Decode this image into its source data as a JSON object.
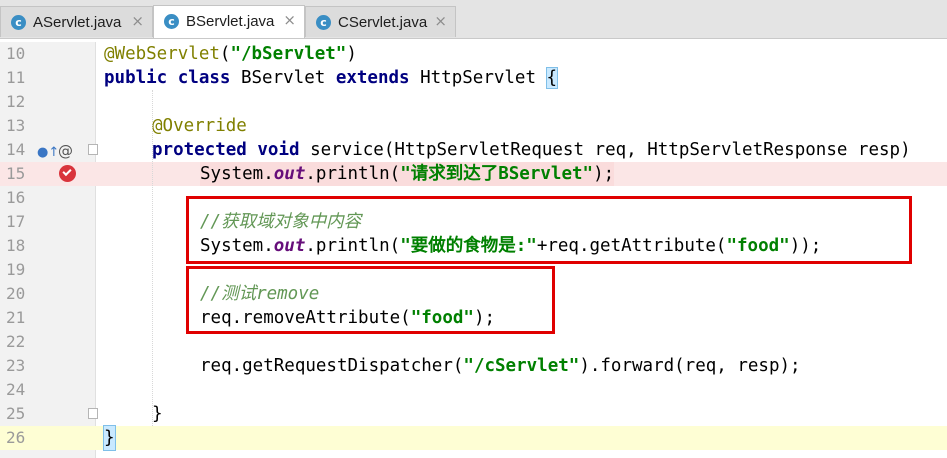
{
  "tabs": [
    {
      "label": "AServlet.java",
      "icon": "c",
      "active": false
    },
    {
      "label": "BServlet.java",
      "icon": "c",
      "active": true
    },
    {
      "label": "CServlet.java",
      "icon": "c",
      "active": false
    }
  ],
  "close_glyph": "×",
  "lines": [
    {
      "num": "10"
    },
    {
      "num": "11"
    },
    {
      "num": "12"
    },
    {
      "num": "13"
    },
    {
      "num": "14"
    },
    {
      "num": "15"
    },
    {
      "num": "16"
    },
    {
      "num": "17"
    },
    {
      "num": "18"
    },
    {
      "num": "19"
    },
    {
      "num": "20"
    },
    {
      "num": "21"
    },
    {
      "num": "22"
    },
    {
      "num": "23"
    },
    {
      "num": "24"
    },
    {
      "num": "25"
    },
    {
      "num": "26"
    }
  ],
  "code": {
    "l10": {
      "annotation": "@WebServlet",
      "p1": "(",
      "str": "\"/bServlet\"",
      "p2": ")"
    },
    "l11": {
      "kw1": "public",
      "kw2": "class",
      "cls": " BServlet ",
      "kw3": "extends",
      "sup": " HttpServlet ",
      "brace": "{"
    },
    "l13": {
      "annotation": "@Override"
    },
    "l14": {
      "kw1": "protected",
      "kw2": "void",
      "rest": " service(HttpServletRequest req, HttpServletResponse resp)"
    },
    "l15": {
      "pre": "System.",
      "field": "out",
      "mid": ".println(",
      "str": "\"请求到达了BServlet\"",
      "post": ");"
    },
    "l17": {
      "comment": "//获取域对象中内容"
    },
    "l18": {
      "pre": "System.",
      "field": "out",
      "mid": ".println(",
      "str1": "\"要做的食物是:\"",
      "mid2": "+req.getAttribute(",
      "str2": "\"food\"",
      "post": "));"
    },
    "l20": {
      "comment": "//测试remove"
    },
    "l21": {
      "pre": "req.removeAttribute(",
      "str": "\"food\"",
      "post": ");"
    },
    "l23": {
      "pre": "req.getRequestDispatcher(",
      "str": "\"/cServlet\"",
      "post": ").forward(req, resp);"
    },
    "l25": {
      "brace": "}"
    },
    "l26": {
      "brace": "}"
    }
  },
  "gutter_icons": {
    "l14_override": "override-marker-icon",
    "l14_at": "@",
    "l15_breakpoint": "breakpoint-icon"
  },
  "colors": {
    "keyword": "#000080",
    "string": "#008000",
    "annotation": "#808000",
    "comment": "#629755",
    "field": "#660e7a",
    "highlight_box": "#e00000",
    "breakpoint": "#d9343c"
  }
}
